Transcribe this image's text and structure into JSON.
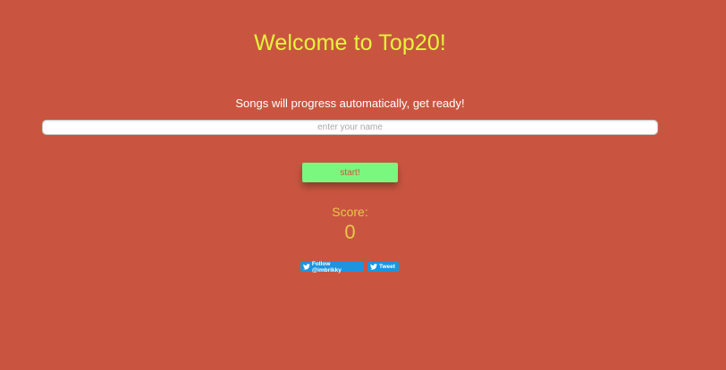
{
  "header": {
    "title": "Welcome to Top20!",
    "subtitle": "Songs will progress automatically, get ready!"
  },
  "name_input": {
    "placeholder": "enter your name",
    "value": ""
  },
  "start_button": {
    "label": "start!"
  },
  "score": {
    "label": "Score:",
    "value": "0"
  },
  "social": {
    "follow_label": "Follow @imbrikky",
    "tweet_label": "Tweet",
    "icon": "twitter-bird-icon"
  },
  "colors": {
    "background": "#c95540",
    "title": "#e4f53a",
    "score": "#e8c848",
    "start_button": "#7af77f",
    "twitter": "#1b95e0"
  }
}
